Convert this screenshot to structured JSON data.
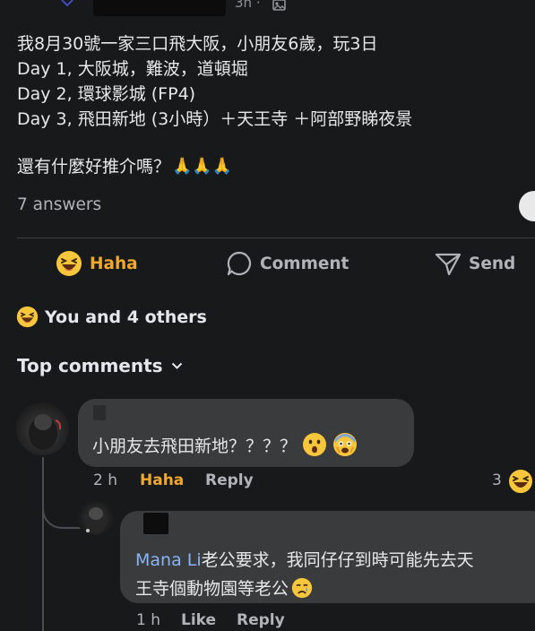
{
  "post": {
    "meta_time": "3h ·",
    "lines": [
      "我8月30號一家三口飛大阪，小朋友6歲，玩3日",
      "Day 1, 大阪城，難波，道頓堀",
      "Day 2, 環球影城 (FP4)",
      "Day 3, 飛田新地 (3小時）＋天王寺 ＋阿部野睇夜景",
      "",
      "還有什麼好推介嗎？"
    ],
    "prayer_emojis": "🙏🙏🙏",
    "answers_count": "7 answers"
  },
  "actions": {
    "haha_label": "Haha",
    "comment_label": "Comment",
    "send_label": "Send"
  },
  "reactions_summary": "You and 4 others",
  "top_comments_label": "Top comments",
  "comments": [
    {
      "text": "小朋友去飛田新地？？？？",
      "time": "2 h",
      "reaction_label": "Haha",
      "reply_label": "Reply",
      "reaction_count": "3"
    },
    {
      "mention": "Mana Li",
      "text_line1": "老公要求，我同仔仔到時可能先去天",
      "text_line2": "王寺個動物園等老公",
      "time": "1 h",
      "like_label": "Like",
      "reply_label": "Reply"
    }
  ],
  "colors": {
    "background": "#18191a",
    "bubble": "#3a3b3c",
    "haha_accent": "#f0a92b",
    "mention": "#8ab4f8",
    "secondary_text": "#b0b3b8"
  },
  "icons": [
    "haha-emoji-icon",
    "comment-bubble-icon",
    "send-icon",
    "chevron-down-icon",
    "surprised-emoji-icon",
    "fearful-emoji-icon",
    "crying-emoji-icon",
    "prayer-hands-icon"
  ]
}
